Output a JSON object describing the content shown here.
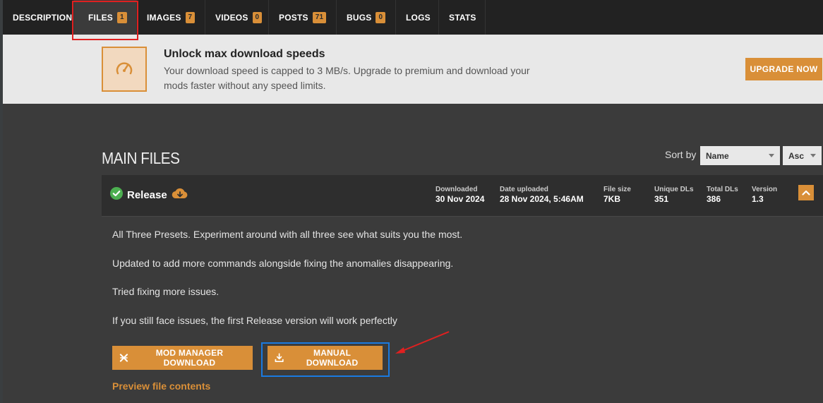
{
  "tabs": [
    {
      "label": "DESCRIPTION",
      "count": ""
    },
    {
      "label": "FILES",
      "count": "1"
    },
    {
      "label": "IMAGES",
      "count": "7"
    },
    {
      "label": "VIDEOS",
      "count": "0"
    },
    {
      "label": "POSTS",
      "count": "71"
    },
    {
      "label": "BUGS",
      "count": "0"
    },
    {
      "label": "LOGS",
      "count": ""
    },
    {
      "label": "STATS",
      "count": ""
    }
  ],
  "banner": {
    "title": "Unlock max download speeds",
    "text": "Your download speed is capped to 3 MB/s. Upgrade to premium and download your mods faster without any speed limits.",
    "upgrade_label": "UPGRADE NOW",
    "icon": "speedometer-icon"
  },
  "main_files": {
    "title": "MAIN FILES",
    "sort_label": "Sort by",
    "sort_field": "Name",
    "sort_order": "Asc"
  },
  "file": {
    "name": "Release",
    "stats": {
      "downloaded_label": "Downloaded",
      "downloaded": "30 Nov 2024",
      "uploaded_label": "Date uploaded",
      "uploaded": "28 Nov 2024, 5:46AM",
      "size_label": "File size",
      "size": "7KB",
      "unique_label": "Unique DLs",
      "unique": "351",
      "total_label": "Total DLs",
      "total": "386",
      "version_label": "Version",
      "version": "1.3"
    },
    "description": [
      "All Three Presets. Experiment around with all three see what suits you the most.",
      "Updated to add more commands alongside fixing the anomalies disappearing.",
      "Tried fixing more issues.",
      "If you still face issues, the first Release version will work perfectly"
    ],
    "mod_manager_label": "MOD MANAGER DOWNLOAD",
    "manual_label": "MANUAL DOWNLOAD",
    "preview_label": "Preview file contents"
  },
  "colors": {
    "accent": "#d98f38",
    "highlight_red": "#e02020",
    "highlight_blue": "#1a7ae0",
    "success_green": "#4caf50"
  }
}
